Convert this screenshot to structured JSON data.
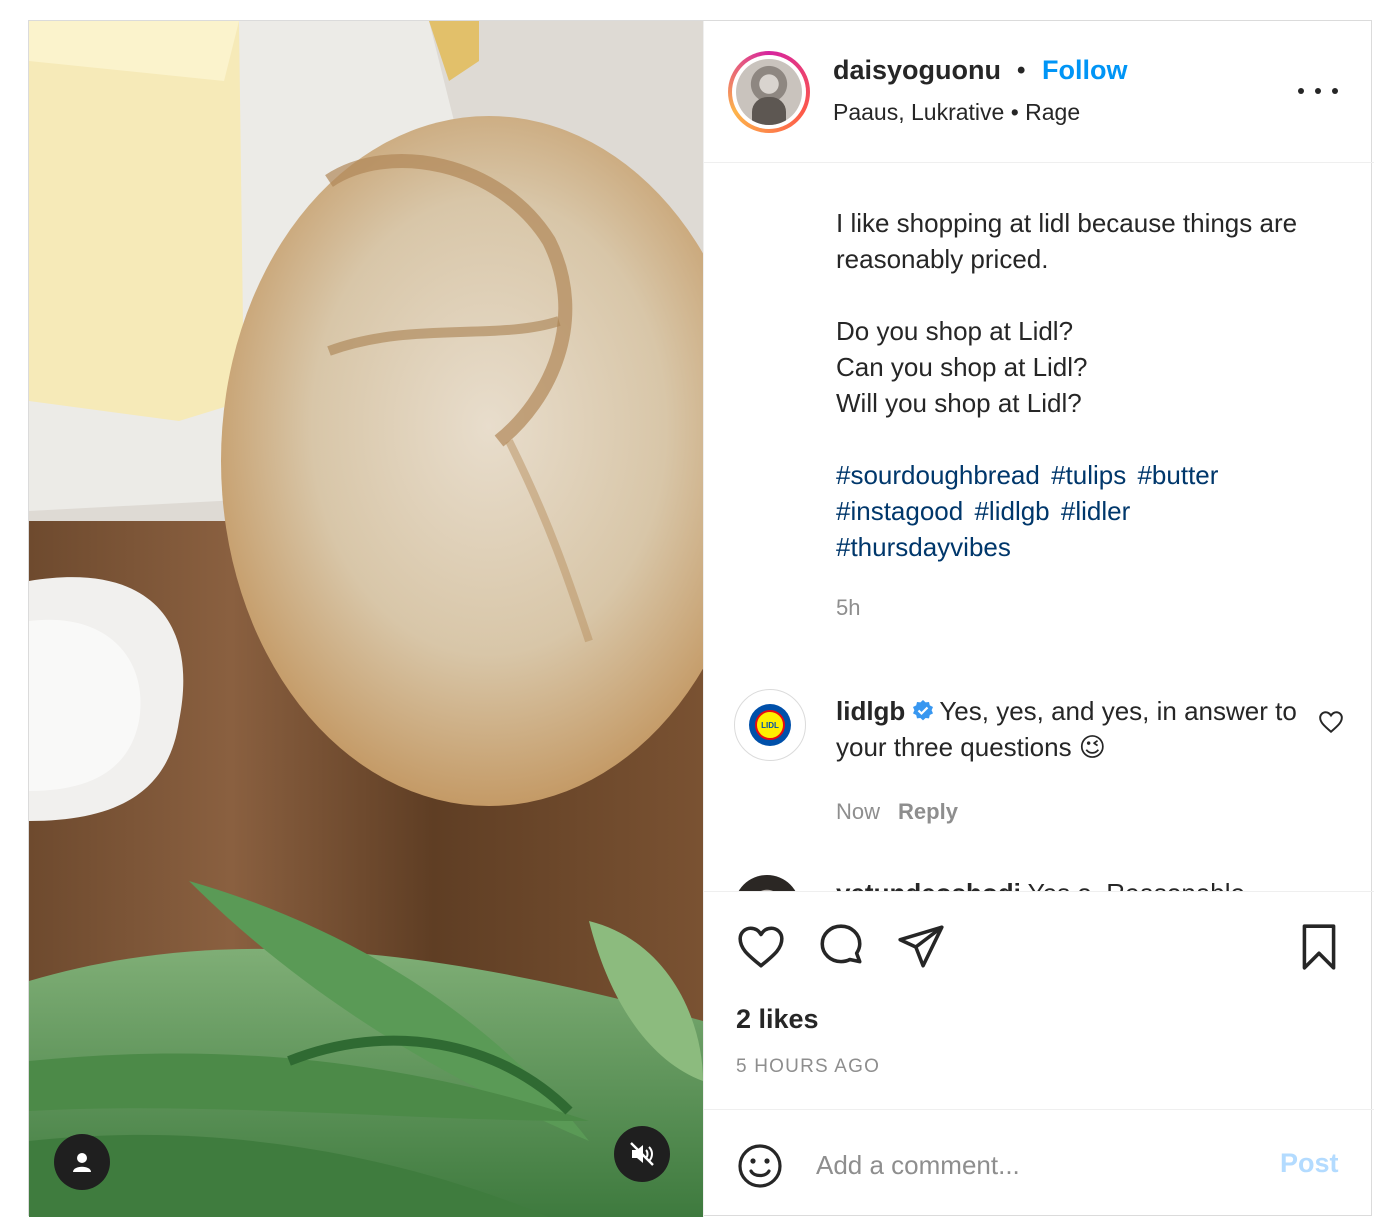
{
  "post": {
    "author": {
      "username": "daisyoguonu",
      "separator": "•",
      "follow_label": "Follow",
      "location": "Paaus, Lukrative • Rage"
    },
    "caption": "I like shopping at lidl because things are reasonably priced.\n\nDo you shop at Lidl?\nCan you shop at Lidl?\nWill you shop at Lidl?",
    "hashtags": [
      "#sourdoughbread",
      "#tulips",
      "#butter",
      "#instagood",
      "#lidlgb",
      "#lidler",
      "#thursdayvibes"
    ],
    "caption_time": "5h",
    "comments": [
      {
        "username": "lidlgb",
        "verified": true,
        "text": "Yes, yes, and yes, in answer to your three questions 😉",
        "time": "Now",
        "reply_label": "Reply",
        "avatar_text": "LIDL"
      },
      {
        "username": "yetundeoshodi",
        "text": "Yes o. Reasonable"
      }
    ],
    "likes": "2 likes",
    "time_ago": "5 HOURS AGO",
    "add_comment": {
      "placeholder": "Add a comment...",
      "post_label": "Post"
    }
  },
  "icons": {
    "media": [
      "user-tag-icon",
      "muted-speaker-icon"
    ],
    "actions": [
      "heart-icon",
      "comment-icon",
      "share-icon",
      "bookmark-icon"
    ],
    "comment": [
      "verified-badge-icon",
      "heart-icon"
    ],
    "composer": [
      "emoji-icon"
    ]
  },
  "colors": {
    "link_blue": "#0095f6",
    "hashtag_blue": "#00376b",
    "muted_gray": "#8e8e8e",
    "post_disabled": "#b3dbff"
  }
}
